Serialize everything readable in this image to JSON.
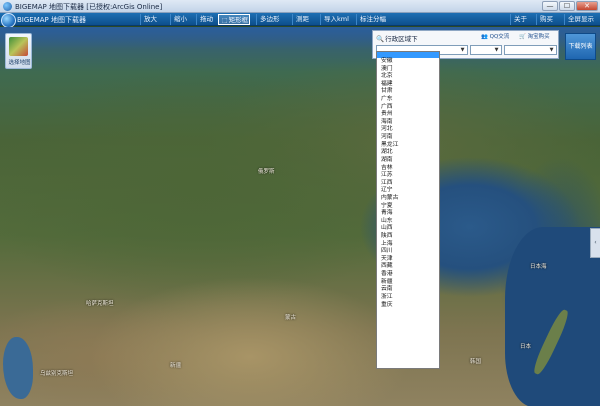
{
  "window": {
    "title": "BIGEMAP 地图下载器 [已授权:ArcGis Online]",
    "minimize": "—",
    "maximize": "☐",
    "close": "✕"
  },
  "toolbar": {
    "app_label": "BIGEMAP 地图下载器",
    "tools": [
      {
        "label": "放大",
        "icon": "zoom-in-icon"
      },
      {
        "label": "缩小",
        "icon": "zoom-out-icon"
      },
      {
        "label": "拖动",
        "icon": "hand-icon"
      },
      {
        "label": "矩形框",
        "icon": "rectangle-select-icon",
        "active": true
      },
      {
        "label": "多边形",
        "icon": "polygon-icon"
      },
      {
        "label": "测距",
        "icon": "ruler-icon"
      },
      {
        "label": "导入kml",
        "icon": "import-icon"
      },
      {
        "label": "标注分幅",
        "icon": "grid-icon"
      },
      {
        "label": "关于",
        "icon": "info-icon"
      },
      {
        "label": "购买",
        "icon": "cart-icon"
      },
      {
        "label": "全屏显示",
        "icon": "fullscreen-icon"
      }
    ]
  },
  "map_tool": {
    "label": "选择地图"
  },
  "download_button": {
    "label": "下载列表"
  },
  "region_panel": {
    "heading": "行政区域下",
    "pill1": "QQ交流",
    "pill2": "淘宝购买",
    "province_value": "",
    "city_value": ""
  },
  "provinces": [
    "安徽",
    "澳门",
    "北京",
    "福建",
    "甘肃",
    "广东",
    "广西",
    "贵州",
    "海南",
    "河北",
    "河南",
    "黑龙江",
    "湖北",
    "湖南",
    "吉林",
    "江苏",
    "江西",
    "辽宁",
    "内蒙古",
    "宁夏",
    "青海",
    "山东",
    "山西",
    "陕西",
    "上海",
    "四川",
    "天津",
    "西藏",
    "香港",
    "新疆",
    "云南",
    "浙江",
    "重庆"
  ],
  "map_labels": {
    "russia": "俄罗斯",
    "kazakhstan": "哈萨克斯坦",
    "mongolia": "蒙古",
    "japan_sea": "日本海",
    "korea": "韩国",
    "japan": "日本",
    "uzbekistan": "乌兹别克斯坦",
    "xinjiang": "新疆"
  },
  "edge_tab": "‹"
}
